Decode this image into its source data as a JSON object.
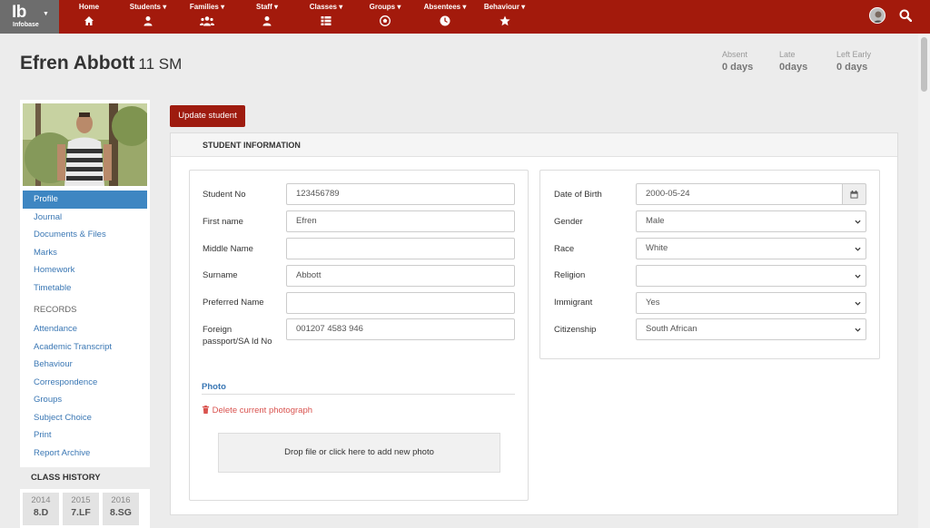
{
  "brand": {
    "logo": "Ib",
    "name": "Infobase"
  },
  "nav": [
    {
      "label": "Home",
      "icon": "home-icon"
    },
    {
      "label": "Students ▾",
      "icon": "user-icon"
    },
    {
      "label": "Families ▾",
      "icon": "users-icon"
    },
    {
      "label": "Staff ▾",
      "icon": "user-icon"
    },
    {
      "label": "Classes ▾",
      "icon": "list-icon"
    },
    {
      "label": "Groups ▾",
      "icon": "soccer-ball-icon"
    },
    {
      "label": "Absentees ▾",
      "icon": "clock-icon"
    },
    {
      "label": "Behaviour ▾",
      "icon": "star-icon"
    }
  ],
  "student": {
    "name": "Efren Abbott",
    "class": "11 SM"
  },
  "stats": [
    {
      "label": "Absent",
      "value": "0 days"
    },
    {
      "label": "Late",
      "value": "0days"
    },
    {
      "label": "Left Early",
      "value": "0 days"
    }
  ],
  "sidebar": {
    "links": [
      "Profile",
      "Journal",
      "Documents & Files",
      "Marks",
      "Homework",
      "Timetable"
    ],
    "records_heading": "RECORDS",
    "records": [
      "Attendance",
      "Academic Transcript",
      "Behaviour",
      "Correspondence",
      "Groups",
      "Subject Choice",
      "Print",
      "Report Archive"
    ],
    "class_history_heading": "CLASS HISTORY",
    "class_history": [
      {
        "year": "2014",
        "class": "8.D"
      },
      {
        "year": "2015",
        "class": "7.LF"
      },
      {
        "year": "2016",
        "class": "8.SG"
      }
    ]
  },
  "update_button": "Update student",
  "panel_title": "STUDENT INFORMATION",
  "left_fields": [
    {
      "label": "Student No",
      "value": "123456789"
    },
    {
      "label": "First name",
      "value": "Efren"
    },
    {
      "label": "Middle Name",
      "value": ""
    },
    {
      "label": "Surname",
      "value": "Abbott"
    },
    {
      "label": "Preferred Name",
      "value": ""
    },
    {
      "label": "Foreign passport/SA Id No",
      "value": "001207 4583 946"
    }
  ],
  "right_fields": [
    {
      "label": "Date of Birth",
      "value": "2000-05-24"
    },
    {
      "label": "Gender",
      "value": "Male"
    },
    {
      "label": "Race",
      "value": "White"
    },
    {
      "label": "Religion",
      "value": ""
    },
    {
      "label": "Immigrant",
      "value": "Yes"
    },
    {
      "label": "Citizenship",
      "value": "South African"
    }
  ],
  "photo_section": {
    "heading": "Photo",
    "delete_link": "Delete current photograph",
    "dropzone": "Drop file or click here to add new photo"
  },
  "colors": {
    "navbar": "#a31a0c",
    "brand_bg": "#6d6d6d",
    "link": "#3a77b4",
    "active": "#3e86c2",
    "danger": "#d9534f"
  }
}
